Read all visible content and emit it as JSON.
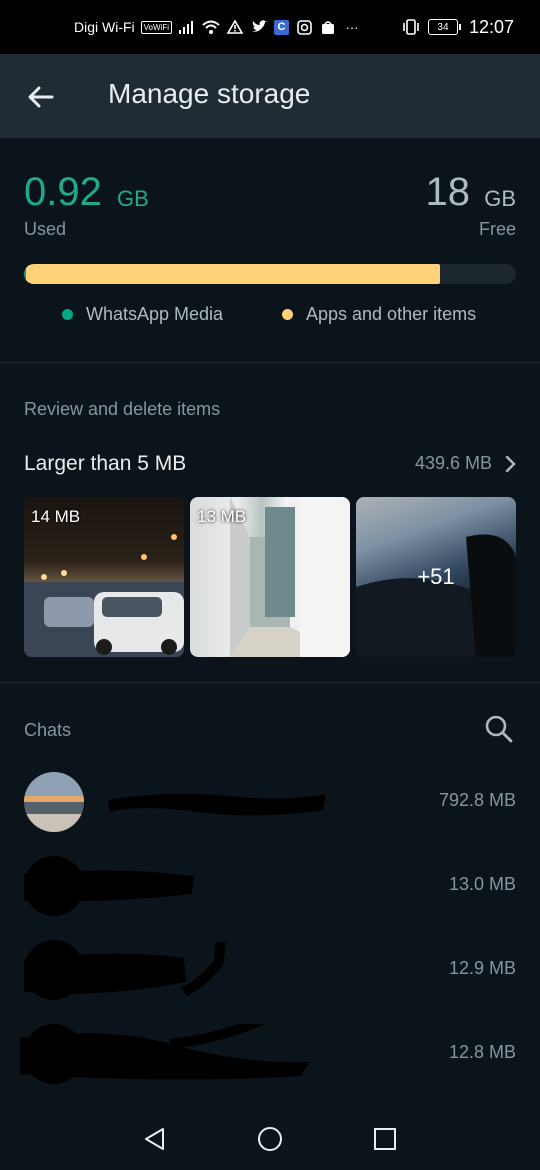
{
  "status_bar": {
    "carrier": "Digi Wi-Fi",
    "vowifi": "VoWiFi",
    "battery": "34",
    "time": "12:07",
    "icons": [
      "signal-icon",
      "wifi-icon",
      "warning-icon",
      "twitter-icon",
      "c-app-icon",
      "instagram-icon",
      "shopping-icon",
      "more-dots-icon",
      "vibrate-icon",
      "battery-icon"
    ]
  },
  "header": {
    "title": "Manage storage",
    "back_icon": "arrow-left-icon"
  },
  "storage": {
    "used_value": "0.92",
    "used_unit": "GB",
    "used_label": "Used",
    "free_value": "18",
    "free_unit": "GB",
    "free_label": "Free",
    "bar": {
      "whatsapp_media_fraction": 0.005,
      "apps_other_fraction": 0.84
    },
    "colors": {
      "media": "#00a884",
      "apps": "#ffd279",
      "accent": "#1faa8c"
    },
    "legend": {
      "media": "WhatsApp Media",
      "apps": "Apps and other items"
    }
  },
  "review": {
    "section_title": "Review and delete items",
    "larger_label": "Larger than 5 MB",
    "larger_size": "439.6 MB",
    "thumbs": [
      {
        "label": "14 MB"
      },
      {
        "label": "13 MB"
      },
      {
        "label": "+51"
      }
    ]
  },
  "chats": {
    "section_title": "Chats",
    "items": [
      {
        "size": "792.8 MB"
      },
      {
        "size": "13.0 MB"
      },
      {
        "size": "12.9 MB"
      },
      {
        "size": "12.8 MB"
      }
    ]
  },
  "nav": {
    "icons": [
      "back-triangle-icon",
      "home-circle-icon",
      "recents-square-icon"
    ]
  }
}
